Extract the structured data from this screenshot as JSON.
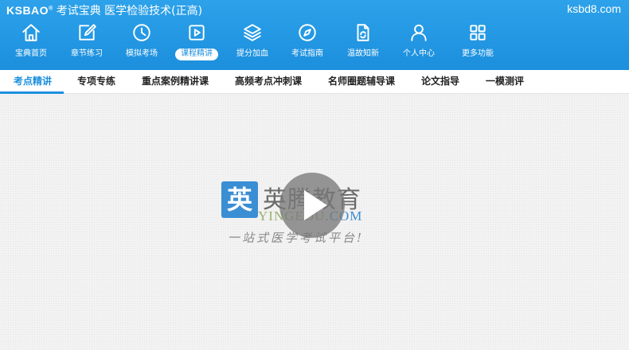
{
  "header": {
    "logo": "KSBAO",
    "logo_mark": "®",
    "app_title": "考试宝典 医学检验技术(正高)",
    "site_url": "ksbd8.com"
  },
  "nav": {
    "items": [
      {
        "label": "宝典首页",
        "icon": "home-icon"
      },
      {
        "label": "章节练习",
        "icon": "edit-icon"
      },
      {
        "label": "模拟考场",
        "icon": "clock-icon"
      },
      {
        "label": "课程精讲",
        "icon": "video-play-icon",
        "active": true
      },
      {
        "label": "提分加血",
        "icon": "layers-icon"
      },
      {
        "label": "考试指南",
        "icon": "compass-icon"
      },
      {
        "label": "温故知新",
        "icon": "refresh-document-icon"
      },
      {
        "label": "个人中心",
        "icon": "user-icon"
      },
      {
        "label": "更多功能",
        "icon": "grid-icon"
      }
    ]
  },
  "tabs": [
    {
      "label": "考点精讲",
      "active": true
    },
    {
      "label": "专项专练"
    },
    {
      "label": "重点案例精讲课"
    },
    {
      "label": "高频考点冲刺课"
    },
    {
      "label": "名师圈题辅导课"
    },
    {
      "label": "论文指导"
    },
    {
      "label": "一模测评"
    }
  ],
  "watermark": {
    "logo_char": "英",
    "name": "英腾教育",
    "domain_main": "YINGEDU",
    "domain_suffix": ".COM",
    "slogan": "一站式医学考试平台!"
  },
  "colors": {
    "primary": "#1c8fdd",
    "header_top": "#2da2ea",
    "background": "#f2f2f2"
  }
}
